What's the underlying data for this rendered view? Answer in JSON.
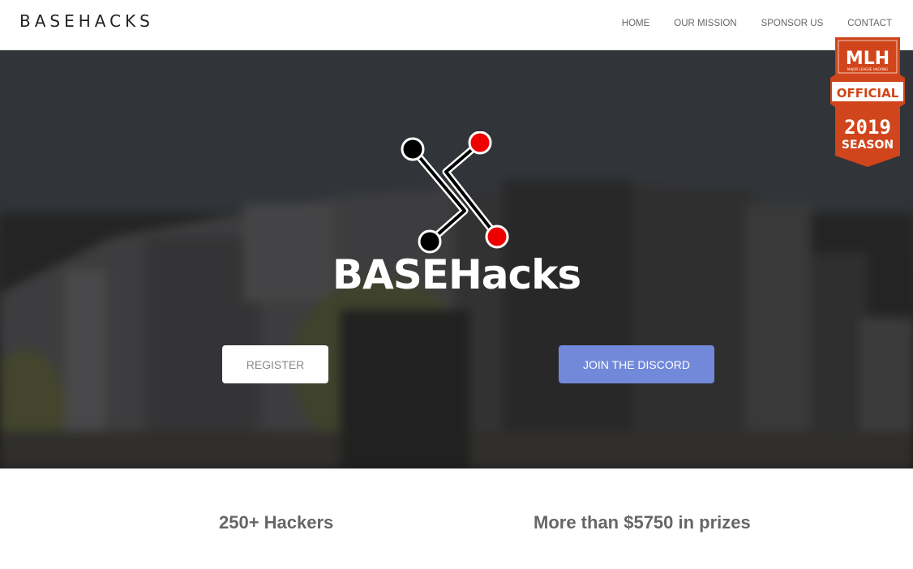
{
  "nav": {
    "brand": "BASEHACKS",
    "links": [
      "HOME",
      "OUR MISSION",
      "SPONSOR US",
      "CONTACT"
    ]
  },
  "hero": {
    "logo_text": "BASEHacks",
    "register_label": "REGISTER",
    "discord_label": "JOIN THE DISCORD",
    "discord_color": "#7289da"
  },
  "mlh_badge": {
    "line1": "MLH",
    "line2": "MAJOR LEAGUE HACKING",
    "line3": "OFFICIAL",
    "line4": "2019",
    "line5": "SEASON",
    "color": "#d0451b"
  },
  "stats": {
    "hackers": "250+ Hackers",
    "prizes": "More than $5750 in prizes"
  }
}
